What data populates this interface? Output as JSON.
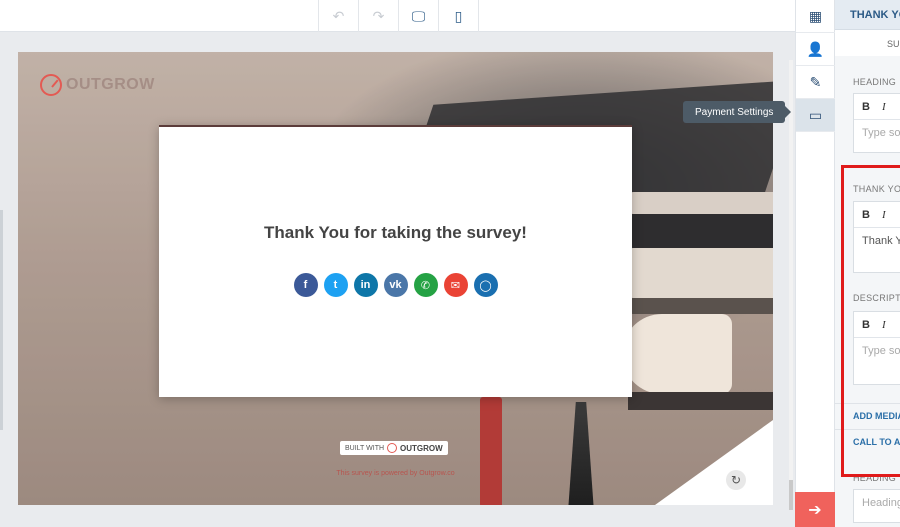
{
  "toolbar": {
    "buttons": [
      {
        "name": "undo-button",
        "icon": "undo-icon",
        "glyph": "↶",
        "active": false
      },
      {
        "name": "redo-button",
        "icon": "redo-icon",
        "glyph": "↷",
        "active": false
      },
      {
        "name": "desktop-view-button",
        "icon": "desktop-icon",
        "glyph": "🖵",
        "active": true
      },
      {
        "name": "mobile-view-button",
        "icon": "mobile-icon",
        "glyph": "▯",
        "active": true
      }
    ]
  },
  "canvas": {
    "logo_text": "OUTGROW",
    "modal_title": "Thank You for taking the survey!",
    "share_buttons": [
      {
        "name": "facebook-share-button",
        "icon": "facebook-icon",
        "glyph": "f",
        "color": "#3b5998"
      },
      {
        "name": "twitter-share-button",
        "icon": "twitter-icon",
        "glyph": "t",
        "color": "#1da1f2"
      },
      {
        "name": "linkedin-share-button",
        "icon": "linkedin-icon",
        "glyph": "in",
        "color": "#0e76a8"
      },
      {
        "name": "vk-share-button",
        "icon": "vk-icon",
        "glyph": "vk",
        "color": "#4a76a8"
      },
      {
        "name": "whatsapp-share-button",
        "icon": "whatsapp-icon",
        "glyph": "✆",
        "color": "#25a244"
      },
      {
        "name": "email-share-button",
        "icon": "email-icon",
        "glyph": "✉",
        "color": "#ea4335"
      },
      {
        "name": "messenger-share-button",
        "icon": "chat-icon",
        "glyph": "◯",
        "color": "#1a6fb0"
      }
    ],
    "powered_text": "This survey is powered by Outgrow.co",
    "built_with_label": "BUILT WITH",
    "built_with_brand": "OUTGROW",
    "reset_glyph": "↻"
  },
  "sidebar_icons": [
    {
      "name": "dashboard-tab",
      "icon": "grid-icon",
      "glyph": "▦",
      "active": false
    },
    {
      "name": "add-user-tab",
      "icon": "add-user-icon",
      "glyph": "👤",
      "active": false
    },
    {
      "name": "edit-tab",
      "icon": "pencil-icon",
      "glyph": "✎",
      "active": false
    },
    {
      "name": "payment-settings-tab",
      "icon": "credit-card-icon",
      "glyph": "▭",
      "active": true
    }
  ],
  "tooltip": {
    "text": "Payment Settings"
  },
  "next_glyph": "➔",
  "panel": {
    "header": "THANK YOU PAGE",
    "sub": "SUBMIT",
    "heading_label": "HEADING",
    "heading_placeholder": "Type some text",
    "thank_you_label": "THANK YOU",
    "thank_you_text": "Thank You",
    "description_label": "DESCRIPTION",
    "description_placeholder": "Type some text",
    "bold": "B",
    "italic": "I",
    "add_media": "ADD MEDIA",
    "call_to_action": "CALL TO ACTION",
    "heading2_label": "HEADING",
    "heading2_placeholder": "Heading"
  }
}
